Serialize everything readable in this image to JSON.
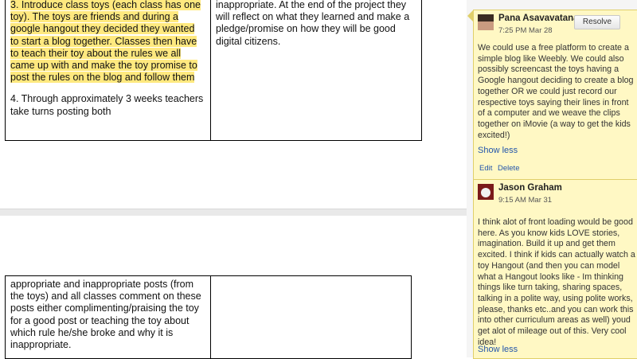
{
  "document": {
    "top_table": {
      "left_highlighted": "3. Introduce class toys (each class has one toy). The toys are friends and during a google hangout they decided they wanted to start a blog together. Classes then have to teach their toy about the rules we all came up with and make the toy promise to post the rules on the blog and follow them",
      "left_normal": "4. Through approximately 3 weeks teachers take turns posting both",
      "right": "inappropriate. At the end of the project they will reflect on what they learned and make a pledge/promise on how they will be good digital citizens."
    },
    "bottom_table": {
      "left": "appropriate and inappropriate posts (from the toys) and all classes comment on these posts either complimenting/praising the toy for a good post or teaching the toy about which rule he/she broke and why it is inappropriate.",
      "right": ""
    }
  },
  "comments": [
    {
      "author": "Pana Asavavatana",
      "time": "7:25 PM Mar 28",
      "resolve_label": "Resolve",
      "body": "We could use a free platform to create a simple blog like Weebly. We could also possibly screencast the toys having a Google hangout deciding to create a blog together OR we could just record our respective toys saying their lines in front of a computer and we weave the clips together on iMovie (a way to get the kids excited!)",
      "show_less": "Show less",
      "edit": "Edit",
      "delete": "Delete"
    },
    {
      "author": "Jason Graham",
      "time": "9:15 AM Mar 31",
      "body": "I think alot of front loading would be good here. As you know kids LOVE stories, imagination. Build it up and get them excited. I think if kids can actually watch a toy Hangout (and then you can model what a Hangout looks like - Im thinking things like turn taking, sharing spaces, talking in a polite way, using polite works, please, thanks etc..and you can work this into other curriculum areas as well) youd get alot of mileage out of this. Very cool idea!",
      "show_less": "Show less"
    }
  ],
  "colors": {
    "highlight": "#ffe97f",
    "comment_bg": "#fff8c4",
    "link": "#2255aa"
  }
}
